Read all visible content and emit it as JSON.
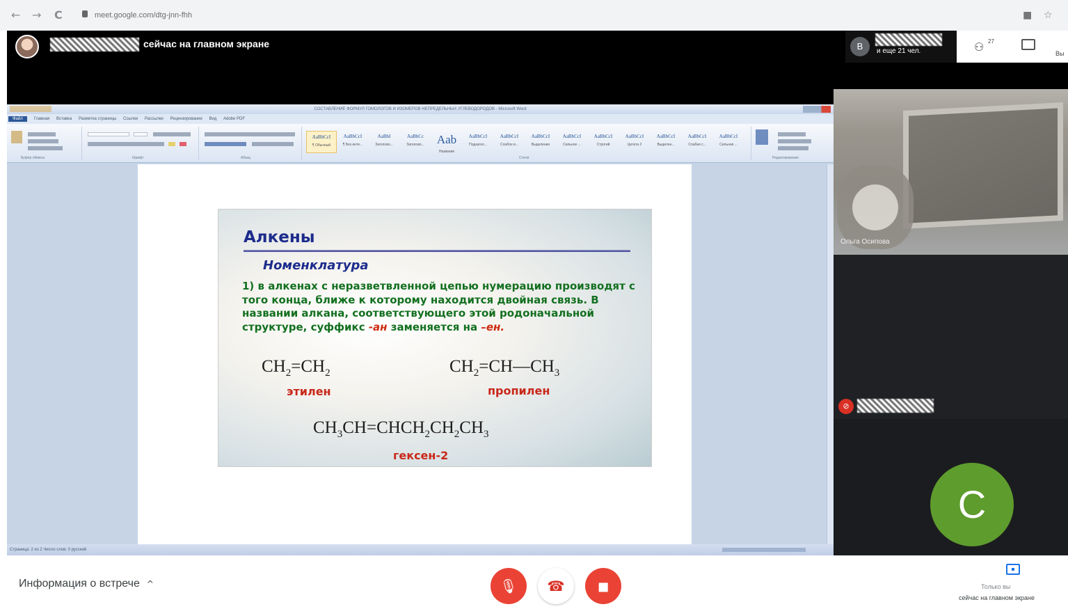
{
  "browser": {
    "url": "meet.google.com/dtg-jnn-fhh",
    "back_icon": "←",
    "forward_icon": "→",
    "reload_icon": "C",
    "star_icon": "☆"
  },
  "meet": {
    "presenter_status": "сейчас на главном экране",
    "participants_count_text": "и еще 21 чел.",
    "participant_badge": "B",
    "people_count": "27",
    "right_cut_label": "Вы",
    "camera_tile_label": "Ольга Осипова",
    "avatar_letter": "C",
    "meeting_info_label": "Информация о встрече",
    "chevron_up": "^",
    "present_label": "Только вы",
    "present_status": "сейчас на главном экране",
    "colors": {
      "mic_off": "#ea4335",
      "avatar": "#5e9c2e",
      "accent": "#1a73e8"
    }
  },
  "word": {
    "title": "СОСТАВЛЕНИЕ ФОРМУЛ ГОМОЛОГОВ И ИЗОМЕРОВ НЕПРЕДЕЛЬНЫХ УГЛЕВОДОРОДОВ - Microsoft Word",
    "tabs": [
      "Файл",
      "Главная",
      "Вставка",
      "Разметка страницы",
      "Ссылки",
      "Рассылки",
      "Рецензирование",
      "Вид",
      "Adobe PDF"
    ],
    "ribbon_groups": [
      "Буфер обмена",
      "Шрифт",
      "Абзац",
      "Стили",
      "Редактирование"
    ],
    "styles": [
      {
        "sample": "AaBbCcI",
        "name": "¶ Обычный",
        "active": true
      },
      {
        "sample": "AaBbCcI",
        "name": "¶ Без инте..."
      },
      {
        "sample": "AaBbI",
        "name": "Заголово..."
      },
      {
        "sample": "AaBbCc",
        "name": "Заголово..."
      },
      {
        "sample": "Aab",
        "name": "Название",
        "big": true
      },
      {
        "sample": "AaBbCcI",
        "name": "Подзагол..."
      },
      {
        "sample": "AaBbCcI",
        "name": "Слабое в..."
      },
      {
        "sample": "AaBbCcI",
        "name": "Выделение"
      },
      {
        "sample": "AaBbCcI",
        "name": "Сильное ..."
      },
      {
        "sample": "AaBbCcI",
        "name": "Строгий"
      },
      {
        "sample": "AaBbCcI",
        "name": "Цитата 2"
      },
      {
        "sample": "AaBbCcI",
        "name": "Выделен..."
      },
      {
        "sample": "AaBbCcI",
        "name": "Слабая с..."
      },
      {
        "sample": "AaBbCcI",
        "name": "Сильная ..."
      }
    ],
    "status_text": "Страница: 2 из 2   Число слов: 0   русский"
  },
  "slide": {
    "title": "Алкены",
    "subtitle": "Номенклатура",
    "body_main": "1) в алкенах с неразветвленной цепью нумерацию производят с того конца, ближе к которому находится двойная связь. В названии алкана, соответствующего этой родоначальной структуре, суффикс ",
    "suffix_an": "-ан",
    "body_mid": " заменяется на ",
    "suffix_en": "–ен.",
    "ethylene_name": "этилен",
    "propylene_name": "пропилен",
    "hexene_name": "гексен-2"
  }
}
